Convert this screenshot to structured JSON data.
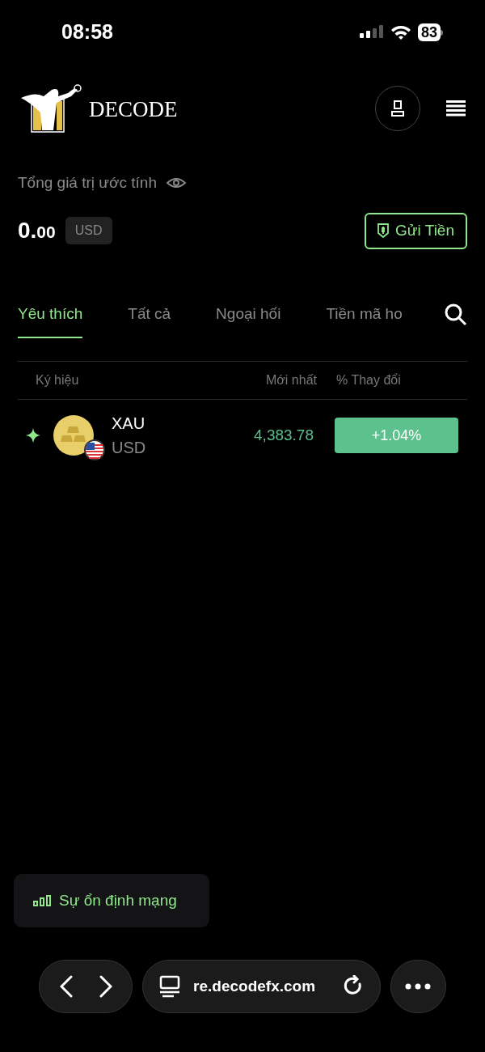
{
  "status_bar": {
    "time": "08:58",
    "battery": "83"
  },
  "header": {
    "brand": "DECODE"
  },
  "balance": {
    "label": "Tổng giá trị ước tính",
    "amount_integer": "0.",
    "amount_decimals": "00",
    "currency": "USD",
    "deposit_button": "Gửi Tiền"
  },
  "tabs": [
    {
      "label": "Yêu thích",
      "selected": true
    },
    {
      "label": "Tất cả",
      "selected": false
    },
    {
      "label": "Ngoại hối",
      "selected": false
    },
    {
      "label": "Tiền mã ho",
      "selected": false
    }
  ],
  "table": {
    "columns": [
      "Ký hiệu",
      "Mới nhất",
      "% Thay đổi"
    ],
    "rows": [
      {
        "favorite": true,
        "symbol": "XAU",
        "quote": "USD",
        "price": "4,383.78",
        "change": "+1.04%"
      }
    ]
  },
  "network_badge": "Sự ổn định mạng",
  "browser_bar": {
    "url": "re.decodefx.com"
  }
}
